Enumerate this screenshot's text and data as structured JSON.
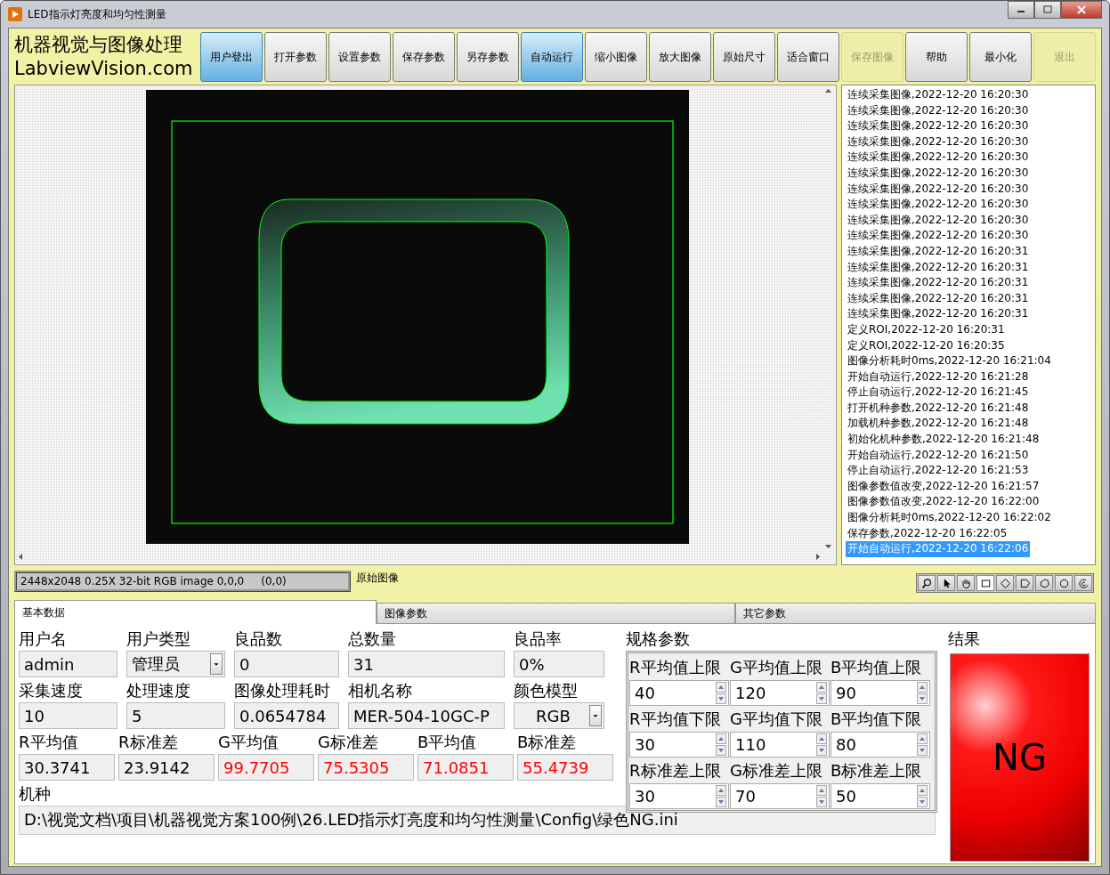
{
  "window": {
    "title": "LED指示灯亮度和均匀性测量"
  },
  "brand": {
    "line1": "机器视觉与图像处理",
    "line2": "LabviewVision.com"
  },
  "toolbar": [
    {
      "label": "用户登出",
      "active": true,
      "disabled": false
    },
    {
      "label": "打开参数",
      "active": false,
      "disabled": false
    },
    {
      "label": "设置参数",
      "active": false,
      "disabled": false
    },
    {
      "label": "保存参数",
      "active": false,
      "disabled": false
    },
    {
      "label": "另存参数",
      "active": false,
      "disabled": false
    },
    {
      "label": "自动运行",
      "active": true,
      "disabled": false
    },
    {
      "label": "缩小图像",
      "active": false,
      "disabled": false
    },
    {
      "label": "放大图像",
      "active": false,
      "disabled": false
    },
    {
      "label": "原始尺寸",
      "active": false,
      "disabled": false
    },
    {
      "label": "适合窗口",
      "active": false,
      "disabled": false
    },
    {
      "label": "保存图像",
      "active": false,
      "disabled": true
    },
    {
      "label": "帮助",
      "active": false,
      "disabled": false
    },
    {
      "label": "最小化",
      "active": false,
      "disabled": false
    },
    {
      "label": "退出",
      "active": false,
      "disabled": true
    }
  ],
  "log": [
    {
      "text": "连续采集图像,2022-12-20 16:20:30",
      "selected": false
    },
    {
      "text": "连续采集图像,2022-12-20 16:20:30",
      "selected": false
    },
    {
      "text": "连续采集图像,2022-12-20 16:20:30",
      "selected": false
    },
    {
      "text": "连续采集图像,2022-12-20 16:20:30",
      "selected": false
    },
    {
      "text": "连续采集图像,2022-12-20 16:20:30",
      "selected": false
    },
    {
      "text": "连续采集图像,2022-12-20 16:20:30",
      "selected": false
    },
    {
      "text": "连续采集图像,2022-12-20 16:20:30",
      "selected": false
    },
    {
      "text": "连续采集图像,2022-12-20 16:20:30",
      "selected": false
    },
    {
      "text": "连续采集图像,2022-12-20 16:20:30",
      "selected": false
    },
    {
      "text": "连续采集图像,2022-12-20 16:20:30",
      "selected": false
    },
    {
      "text": "连续采集图像,2022-12-20 16:20:31",
      "selected": false
    },
    {
      "text": "连续采集图像,2022-12-20 16:20:31",
      "selected": false
    },
    {
      "text": "连续采集图像,2022-12-20 16:20:31",
      "selected": false
    },
    {
      "text": "连续采集图像,2022-12-20 16:20:31",
      "selected": false
    },
    {
      "text": "连续采集图像,2022-12-20 16:20:31",
      "selected": false
    },
    {
      "text": "定义ROI,2022-12-20 16:20:31",
      "selected": false
    },
    {
      "text": "定义ROI,2022-12-20 16:20:35",
      "selected": false
    },
    {
      "text": "图像分析耗时0ms,2022-12-20 16:21:04",
      "selected": false
    },
    {
      "text": "开始自动运行,2022-12-20 16:21:28",
      "selected": false
    },
    {
      "text": "停止自动运行,2022-12-20 16:21:45",
      "selected": false
    },
    {
      "text": "打开机种参数,2022-12-20 16:21:48",
      "selected": false
    },
    {
      "text": "加载机种参数,2022-12-20 16:21:48",
      "selected": false
    },
    {
      "text": "初始化机种参数,2022-12-20 16:21:48",
      "selected": false
    },
    {
      "text": "开始自动运行,2022-12-20 16:21:50",
      "selected": false
    },
    {
      "text": "停止自动运行,2022-12-20 16:21:53",
      "selected": false
    },
    {
      "text": "图像参数值改变,2022-12-20 16:21:57",
      "selected": false
    },
    {
      "text": "图像参数值改变,2022-12-20 16:22:00",
      "selected": false
    },
    {
      "text": "图像分析耗时0ms,2022-12-20 16:22:02",
      "selected": false
    },
    {
      "text": "保存参数,2022-12-20 16:22:05",
      "selected": false
    },
    {
      "text": "开始自动运行,2022-12-20 16:22:06",
      "selected": true
    }
  ],
  "image_info": "2448x2048 0.25X 32-bit RGB image 0,0,0     (0,0)",
  "image_label": "原始图像",
  "tools": [
    {
      "kind": "zoom",
      "selected": false
    },
    {
      "kind": "pointer",
      "selected": false
    },
    {
      "kind": "pan",
      "selected": false
    },
    {
      "kind": "rectangle",
      "selected": true
    },
    {
      "kind": "rotated-rectangle",
      "selected": false
    },
    {
      "kind": "polygon",
      "selected": false
    },
    {
      "kind": "freehand",
      "selected": false
    },
    {
      "kind": "oval",
      "selected": false
    },
    {
      "kind": "annulus",
      "selected": false
    }
  ],
  "tabs": [
    {
      "label": "基本数据",
      "selected": true
    },
    {
      "label": "图像参数",
      "selected": false
    },
    {
      "label": "其它参数",
      "selected": false
    }
  ],
  "basic": {
    "row1": [
      {
        "label": "用户名",
        "value": "admin",
        "kind": "text"
      },
      {
        "label": "用户类型",
        "value": "管理员",
        "kind": "dropdown"
      },
      {
        "label": "良品数",
        "value": "0",
        "kind": "text"
      },
      {
        "label": "总数量",
        "value": "31",
        "kind": "text"
      },
      {
        "label": "良品率",
        "value": "0%",
        "kind": "text"
      }
    ],
    "row2": [
      {
        "label": "采集速度",
        "value": "10",
        "kind": "text"
      },
      {
        "label": "处理速度",
        "value": "5",
        "kind": "text"
      },
      {
        "label": "图像处理耗时",
        "value": "0.0654784",
        "kind": "text"
      },
      {
        "label": "相机名称",
        "value": "MER-504-10GC-P",
        "kind": "text"
      },
      {
        "label": "颜色模型",
        "value": "RGB",
        "kind": "dropdown"
      }
    ],
    "stats": [
      {
        "label": "R平均值",
        "value": "30.3741",
        "alarm": false
      },
      {
        "label": "R标准差",
        "value": "23.9142",
        "alarm": false
      },
      {
        "label": "G平均值",
        "value": "99.7705",
        "alarm": true
      },
      {
        "label": "G标准差",
        "value": "75.5305",
        "alarm": true
      },
      {
        "label": "B平均值",
        "value": "71.0851",
        "alarm": true
      },
      {
        "label": "B标准差",
        "value": "55.4739",
        "alarm": true
      }
    ],
    "model_label": "机种",
    "model_path": "D:\\视觉文档\\项目\\机器视觉方案100例\\26.LED指示灯亮度和均匀性测量\\Config\\绿色NG.ini"
  },
  "spec": {
    "title": "规格参数",
    "rows": [
      {
        "labels": [
          "R平均值上限",
          "G平均值上限",
          "B平均值上限"
        ],
        "values": [
          "40",
          "120",
          "90"
        ]
      },
      {
        "labels": [
          "R平均值下限",
          "G平均值下限",
          "B平均值下限"
        ],
        "values": [
          "30",
          "110",
          "80"
        ]
      },
      {
        "labels": [
          "R标准差上限",
          "G标准差上限",
          "B标准差上限"
        ],
        "values": [
          "30",
          "70",
          "50"
        ]
      }
    ]
  },
  "result": {
    "title": "结果",
    "text": "NG",
    "pass": false
  }
}
